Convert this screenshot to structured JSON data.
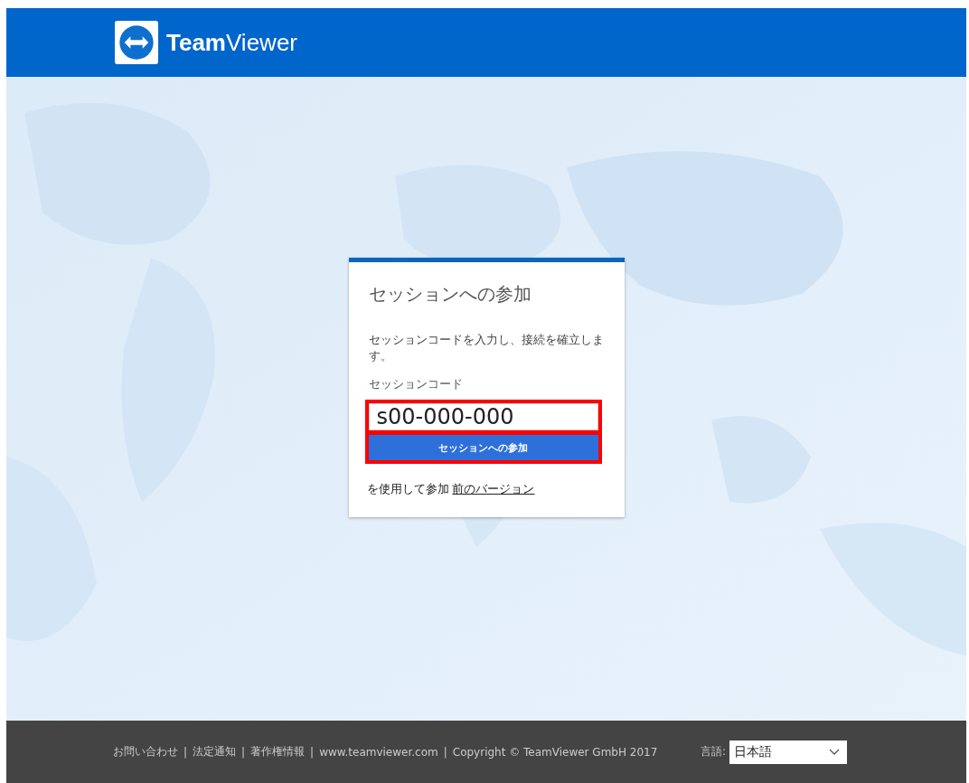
{
  "header": {
    "brand_bold": "Team",
    "brand_light": "Viewer"
  },
  "card": {
    "title": "セッションへの参加",
    "description": "セッションコードを入力し、接続を確立します。",
    "field_label": "セッションコード",
    "field_value": "s00-000-000",
    "button": "セッションへの参加",
    "highlighted": true,
    "alt_prefix": "を使用して参加",
    "alt_link": "前のバージョン"
  },
  "footer": {
    "separator": "|",
    "links": [
      "お問い合わせ",
      "法定通知",
      "著作権情報",
      "www.teamviewer.com"
    ],
    "copyright": "Copyright © TeamViewer GmbH 2017",
    "language_label": "言語:",
    "language_value": "日本語"
  }
}
